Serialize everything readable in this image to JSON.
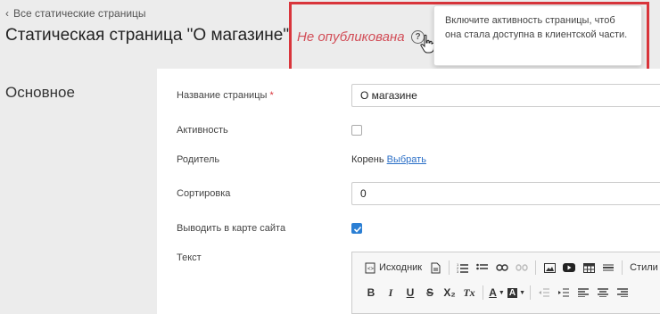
{
  "nav": {
    "back_label": "Все статические страницы"
  },
  "header": {
    "title": "Статическая страница \"О магазине\"",
    "status": "Не опубликована",
    "help_icon": "question-circle-icon",
    "tooltip": "Включите активность страницы, чтоб она стала доступна в клиентской части."
  },
  "section": {
    "title": "Основное"
  },
  "form": {
    "name": {
      "label": "Название страницы",
      "required_mark": "*",
      "value": "О магазине"
    },
    "activity": {
      "label": "Активность",
      "checked": false
    },
    "parent": {
      "label": "Родитель",
      "value": "Корень",
      "select_link": "Выбрать"
    },
    "sort": {
      "label": "Сортировка",
      "value": "0"
    },
    "sitemap": {
      "label": "Выводить в карте сайта",
      "checked": true
    },
    "text": {
      "label": "Текст"
    }
  },
  "editor": {
    "source_label": "Исходник",
    "styles_label": "Стили",
    "row1_icons": [
      "source-icon",
      "document-icon",
      "numbered-list-icon",
      "bullet-list-icon",
      "link-icon",
      "unlink-icon",
      "image-icon",
      "youtube-icon",
      "table-icon",
      "horizontal-rule-icon"
    ],
    "row2": {
      "bold": "B",
      "italic": "I",
      "underline": "U",
      "strike": "S",
      "subscript": "X₂",
      "clear": "Tx",
      "text_color": "A",
      "bg_color": "A"
    }
  },
  "colors": {
    "accent": "#2b7fd4",
    "status": "#d24d57",
    "highlight_border": "#d9353b",
    "link": "#2b6fc7"
  }
}
